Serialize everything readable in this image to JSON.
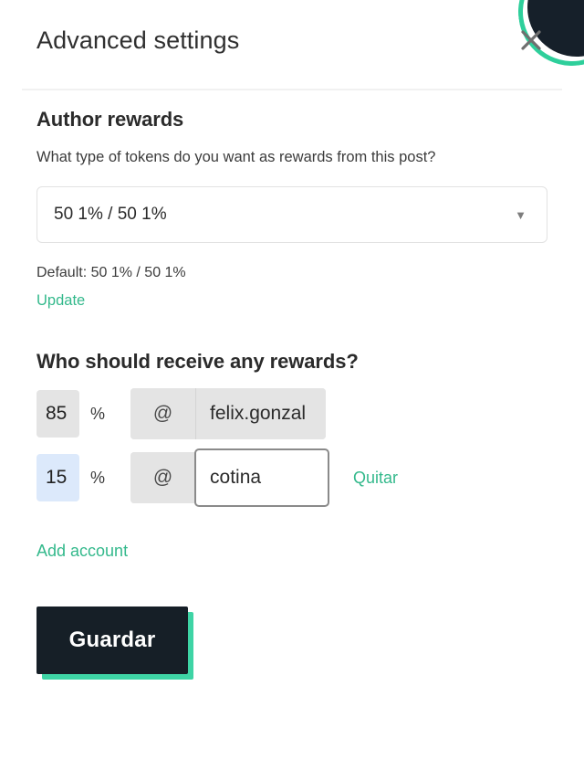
{
  "modal": {
    "title": "Advanced settings",
    "close_icon": "close-icon"
  },
  "author_rewards": {
    "heading": "Author rewards",
    "question": "What type of tokens do you want as rewards from this post?",
    "select": {
      "value": "50 1% / 50 1%",
      "caret_icon": "chevron-down-icon"
    },
    "default_label": "Default: 50 1% / 50 1%",
    "update_link": "Update"
  },
  "beneficiaries": {
    "heading": "Who should receive any rewards?",
    "at_symbol": "@",
    "percent_symbol": "%",
    "rows": [
      {
        "percent": "85",
        "account": "felix.gonzal",
        "remove_label": ""
      },
      {
        "percent": "15",
        "account": "cotina",
        "remove_label": "Quitar"
      }
    ],
    "add_account_link": "Add account"
  },
  "footer": {
    "save_label": "Guardar"
  },
  "colors": {
    "accent_green": "#34b98c",
    "save_shadow_green": "#3ed4a5",
    "save_bg": "#161f27",
    "highlight_blue": "#dce9fb",
    "field_gray": "#e4e4e4"
  }
}
